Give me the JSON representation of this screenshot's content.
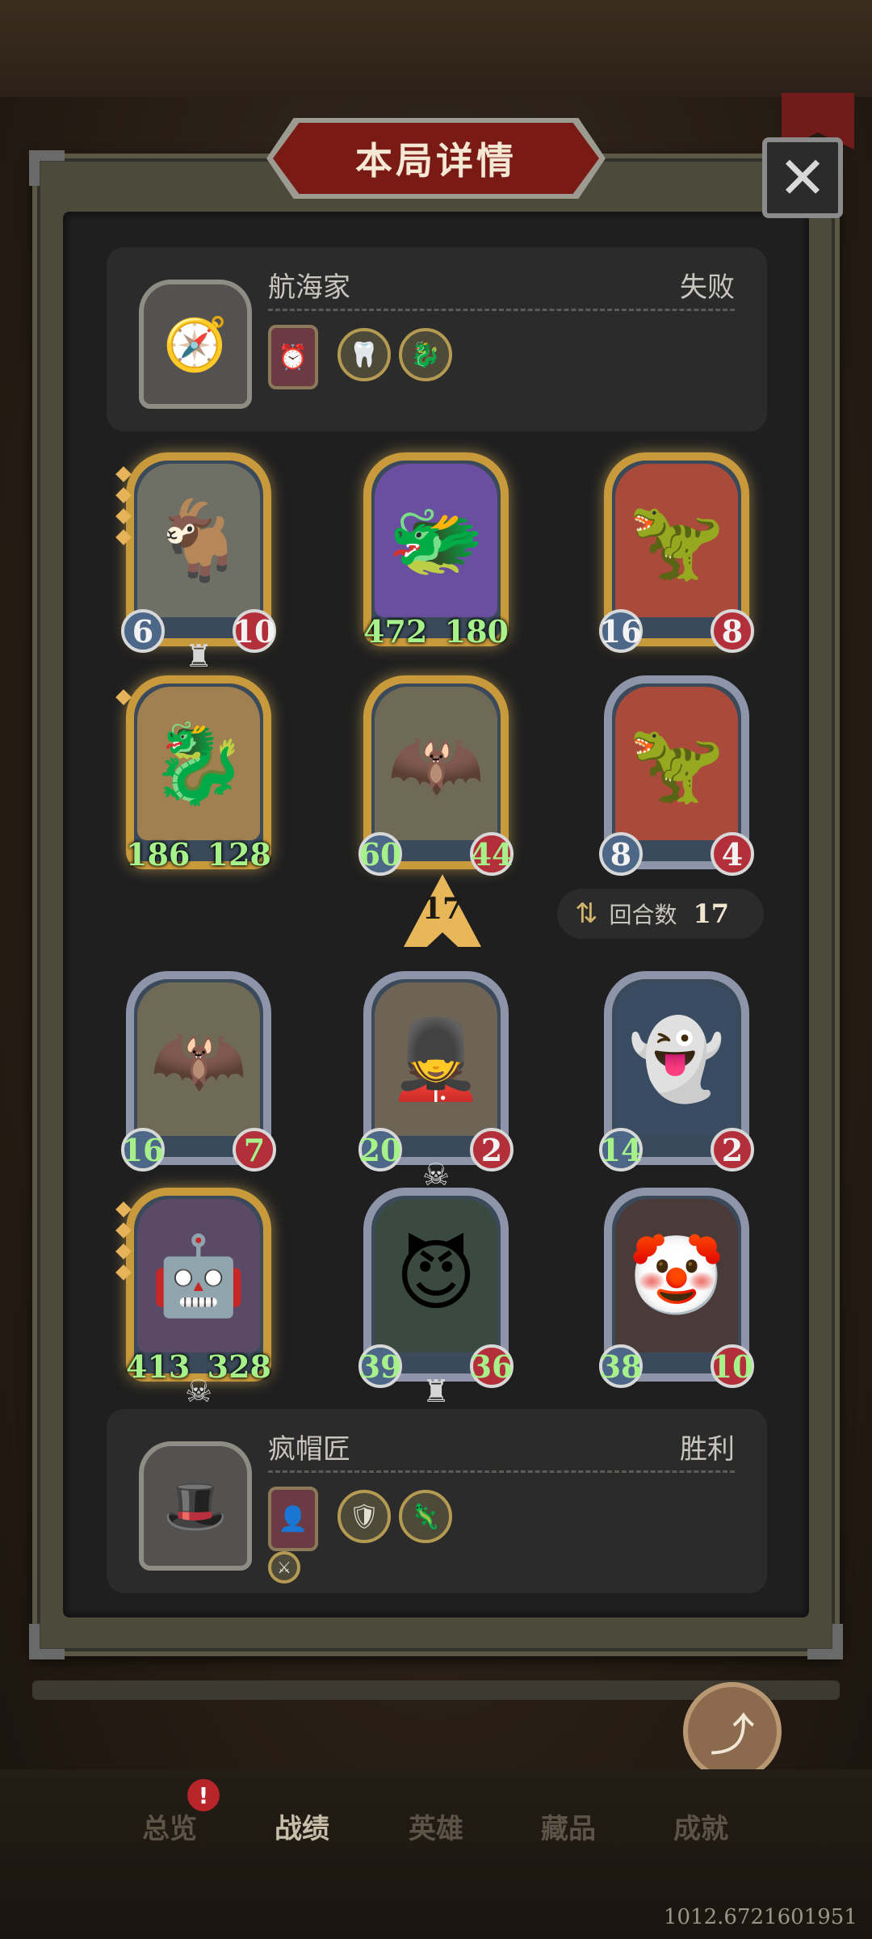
{
  "window": {
    "title": "本局详情",
    "close_icon": "close-icon"
  },
  "opponent": {
    "name": "航海家",
    "result": "失败",
    "portrait_icon": "pirate-portrait",
    "items": [
      {
        "icon": "clock-card-icon",
        "glyph": "⏰"
      },
      {
        "icon": "shark-coin-icon",
        "glyph": "🦷"
      },
      {
        "icon": "dragon-coin-icon",
        "glyph": "🐉"
      }
    ]
  },
  "opponent_board": [
    {
      "name": "goat-dragon",
      "atk": "6",
      "hp": "10",
      "gold": true,
      "tier": 4,
      "buffed_atk": false,
      "buffed_hp": false,
      "glyph": "🐐",
      "art": "#6f7065",
      "deco": "♜"
    },
    {
      "name": "blue-dragon",
      "atk": "472",
      "hp": "180",
      "gold": true,
      "tier": 0,
      "buffed_atk": true,
      "buffed_hp": true,
      "glyph": "🐲",
      "art": "#6a4fa0"
    },
    {
      "name": "green-dragon",
      "atk": "16",
      "hp": "8",
      "gold": true,
      "tier": 0,
      "buffed_atk": false,
      "buffed_hp": false,
      "glyph": "🦖",
      "art": "#a94a3a"
    },
    {
      "name": "white-serpent",
      "atk": "186",
      "hp": "128",
      "gold": true,
      "tier": 1,
      "buffed_atk": true,
      "buffed_hp": true,
      "glyph": "🐉",
      "art": "#a08050"
    },
    {
      "name": "bat-beast",
      "atk": "60",
      "hp": "44",
      "gold": true,
      "tier": 0,
      "buffed_atk": true,
      "buffed_hp": true,
      "glyph": "🦇",
      "art": "#6f6a55"
    },
    {
      "name": "green-dragon-2",
      "atk": "8",
      "hp": "4",
      "gold": false,
      "tier": 0,
      "buffed_atk": false,
      "buffed_hp": false,
      "glyph": "🦖",
      "art": "#a94a3a"
    }
  ],
  "turn": {
    "number": "17",
    "label": "回合数",
    "value": "17",
    "icon": "refresh-icon"
  },
  "player_board": [
    {
      "name": "bat-beast",
      "atk": "16",
      "hp": "7",
      "gold": false,
      "tier": 0,
      "buffed_atk": true,
      "buffed_hp": true,
      "glyph": "🦇",
      "art": "#6f6a55"
    },
    {
      "name": "toy-soldier",
      "atk": "20",
      "hp": "2",
      "gold": false,
      "tier": 0,
      "buffed_atk": true,
      "buffed_hp": false,
      "glyph": "💂",
      "art": "#6d6455",
      "deco": "☠"
    },
    {
      "name": "ghost-beast",
      "atk": "14",
      "hp": "2",
      "gold": false,
      "tier": 0,
      "buffed_atk": true,
      "buffed_hp": false,
      "glyph": "👻",
      "art": "#3a4c62"
    },
    {
      "name": "robot",
      "atk": "413",
      "hp": "328",
      "gold": true,
      "tier": 4,
      "buffed_atk": true,
      "buffed_hp": true,
      "glyph": "🤖",
      "art": "#5a4a68",
      "deco": "☠"
    },
    {
      "name": "demon-girl",
      "atk": "39",
      "hp": "36",
      "gold": false,
      "tier": 0,
      "buffed_atk": true,
      "buffed_hp": true,
      "glyph": "😈",
      "art": "#3a4a40",
      "deco": "♜"
    },
    {
      "name": "clown",
      "atk": "38",
      "hp": "10",
      "gold": false,
      "tier": 0,
      "buffed_atk": true,
      "buffed_hp": true,
      "glyph": "🤡",
      "art": "#4a3a3a"
    }
  ],
  "player": {
    "name": "疯帽匠",
    "result": "胜利",
    "portrait_icon": "mad-hatter-portrait",
    "items": [
      {
        "icon": "hooded-card-icon",
        "glyph": "👤"
      },
      {
        "icon": "rune-coin-icon",
        "glyph": "🛡"
      },
      {
        "icon": "wing-coin-icon",
        "glyph": "🦎"
      },
      {
        "icon": "sword-badge-icon",
        "glyph": "⚔"
      }
    ]
  },
  "share": {
    "label": "分享",
    "icon": "share-icon"
  },
  "nav": {
    "items": [
      "总览",
      "战绩",
      "英雄",
      "藏品",
      "成就"
    ],
    "active": "战绩",
    "badge": "!"
  },
  "version": "1012.6721601951"
}
